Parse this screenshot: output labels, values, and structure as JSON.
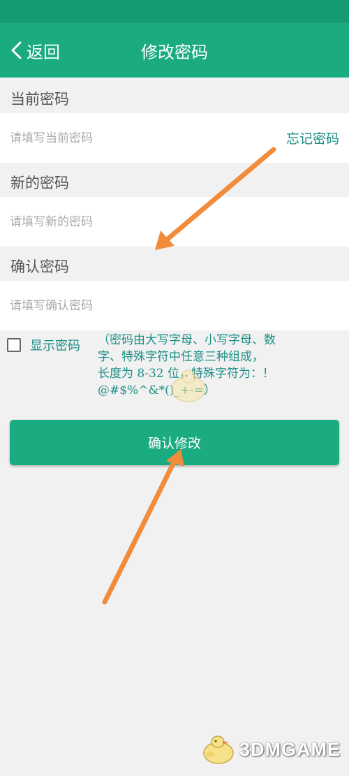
{
  "header": {
    "back_label": "返回",
    "title": "修改密码"
  },
  "sections": {
    "current": {
      "label": "当前密码",
      "placeholder": "请填写当前密码",
      "value": ""
    },
    "new": {
      "label": "新的密码",
      "placeholder": "请填写新的密码",
      "value": ""
    },
    "confirm": {
      "label": "确认密码",
      "placeholder": "请填写确认密码",
      "value": ""
    }
  },
  "forgot_label": "忘记密码",
  "show_password": {
    "label": "显示密码",
    "checked": false
  },
  "note": {
    "line1": "（密码由大写字母、小写字母、数",
    "line2": "字、特殊字符中任意三种组成，",
    "line3": "长度为 8-32 位，特殊字符为：！",
    "line4": "@#$%^&*()_+-=）"
  },
  "confirm_button_label": "确认修改",
  "watermark": "3DMGAME",
  "colors": {
    "status_bar": "#159a72",
    "header": "#1aab80",
    "button": "#1aab80",
    "annotation_text": "#1b8f86",
    "arrow": "#f08c3c",
    "background": "#f1f1f1"
  },
  "icons": {
    "back": "chevron-left-icon",
    "checkbox": "checkbox-unchecked-icon",
    "annotation_arrow": "arrow-icon",
    "watermark_mascot": "duck-mascot-icon"
  }
}
